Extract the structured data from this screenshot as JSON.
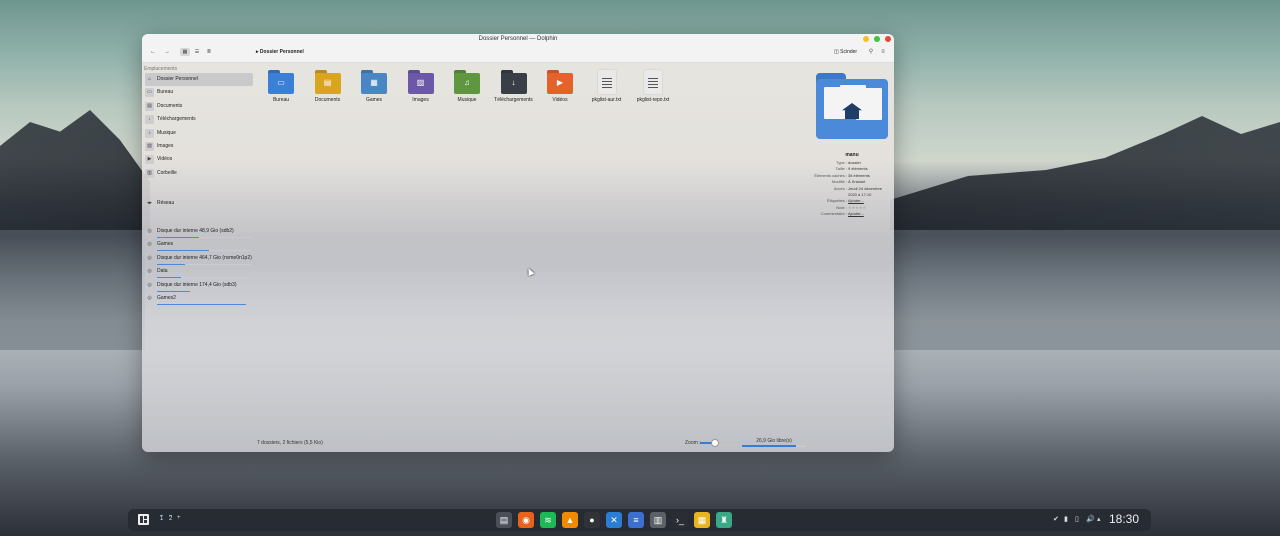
{
  "window": {
    "title": "Dossier Personnel — Dolphin",
    "breadcrumb": "Dossier Personnel",
    "split_label": "Scinder"
  },
  "sidebar": {
    "heading": "Emplacements",
    "places": [
      {
        "label": "Dossier Personnel",
        "icon": "home-icon",
        "selected": true
      },
      {
        "label": "Bureau",
        "icon": "desktop-icon"
      },
      {
        "label": "Documents",
        "icon": "documents-icon"
      },
      {
        "label": "Téléchargements",
        "icon": "downloads-icon"
      },
      {
        "label": "Musique",
        "icon": "music-icon"
      },
      {
        "label": "Images",
        "icon": "images-icon"
      },
      {
        "label": "Vidéos",
        "icon": "videos-icon"
      },
      {
        "label": "Corbeille",
        "icon": "trash-icon"
      }
    ],
    "network": {
      "label": "Réseau",
      "icon": "network-icon"
    },
    "devices": [
      {
        "label": "Disque dur interne 48,9 Gio (sdb2)",
        "fill": 0.45
      },
      {
        "label": "Games",
        "fill": 0.55
      },
      {
        "label": "Disque dur interne 464,7 Gio (nvme0n1p2)",
        "fill": 0.3
      },
      {
        "label": "Data",
        "fill": 0.25
      },
      {
        "label": "Disque dur interne 174,4 Gio (sdb3)",
        "fill": 0.35
      },
      {
        "label": "Games2",
        "fill": 0.95
      }
    ]
  },
  "files": [
    {
      "name": "Bureau",
      "kind": "folder",
      "color": "#3b7fd6",
      "icon": "desktop-folder-icon"
    },
    {
      "name": "Documents",
      "kind": "folder",
      "color": "#d9a520",
      "icon": "documents-folder-icon"
    },
    {
      "name": "Games",
      "kind": "folder",
      "color": "#4a86c5",
      "icon": "games-folder-icon"
    },
    {
      "name": "Images",
      "kind": "folder",
      "color": "#6d58a8",
      "icon": "images-folder-icon"
    },
    {
      "name": "Musique",
      "kind": "folder",
      "color": "#5f9640",
      "icon": "music-folder-icon"
    },
    {
      "name": "Téléchargements",
      "kind": "folder",
      "color": "#3a3f47",
      "icon": "downloads-folder-icon"
    },
    {
      "name": "Vidéos",
      "kind": "folder",
      "color": "#e5622c",
      "icon": "videos-folder-icon"
    },
    {
      "name": "pkglist-aur.txt",
      "kind": "text",
      "icon": "text-file-icon"
    },
    {
      "name": "pkglist-repo.txt",
      "kind": "text",
      "icon": "text-file-icon"
    }
  ],
  "info": {
    "name": "manu",
    "rows": [
      {
        "key": "Type :",
        "value": "dossier"
      },
      {
        "key": "Taille :",
        "value": "9 éléments"
      },
      {
        "key": "Éléments cachés :",
        "value": "38 éléments"
      },
      {
        "key": "Modifié :",
        "value": "À l'instant"
      },
      {
        "key": "Accès :",
        "value": "Jeudi 24 décembre"
      },
      {
        "key": "",
        "value": "2020 à 17:10"
      },
      {
        "key": "Étiquettes :",
        "value": "Ajouter...",
        "link": true
      },
      {
        "key": "Note :",
        "value": "★★★★★"
      },
      {
        "key": "Commentaire :",
        "value": "Ajouter...",
        "link": true
      }
    ]
  },
  "status": {
    "summary": "7 dossiers, 2 fichiers (5,5 Kio)",
    "zoom_label": "Zoom :",
    "zoom_level": 0.35,
    "free_space": "26,9 Gio libre(s)",
    "used_fraction": 0.85
  },
  "taskbar": {
    "pager": [
      "1",
      "2",
      "+"
    ],
    "apps": [
      {
        "name": "files-app-icon",
        "color": "#4a4f58",
        "glyph": "▤"
      },
      {
        "name": "firefox-icon",
        "color": "#e8631a",
        "glyph": "◉"
      },
      {
        "name": "spotify-icon",
        "color": "#1db954",
        "glyph": "≋"
      },
      {
        "name": "vlc-icon",
        "color": "#f08a00",
        "glyph": "▲"
      },
      {
        "name": "obs-icon",
        "color": "#303338",
        "glyph": "●"
      },
      {
        "name": "vscode-icon",
        "color": "#2b7cd3",
        "glyph": "✕"
      },
      {
        "name": "text-editor-icon",
        "color": "#3d6fd1",
        "glyph": "≡"
      },
      {
        "name": "system-monitor-icon",
        "color": "#5c6068",
        "glyph": "▥"
      },
      {
        "name": "terminal-icon",
        "color": "#2a2d33",
        "glyph": "›_"
      },
      {
        "name": "app-store-icon",
        "color": "#e8b520",
        "glyph": "▦"
      },
      {
        "name": "keepass-icon",
        "color": "#3aa886",
        "glyph": "♜"
      }
    ],
    "tray": [
      "✔",
      "▮",
      "▯",
      "🔊",
      "▴"
    ],
    "clock": "18:30"
  }
}
